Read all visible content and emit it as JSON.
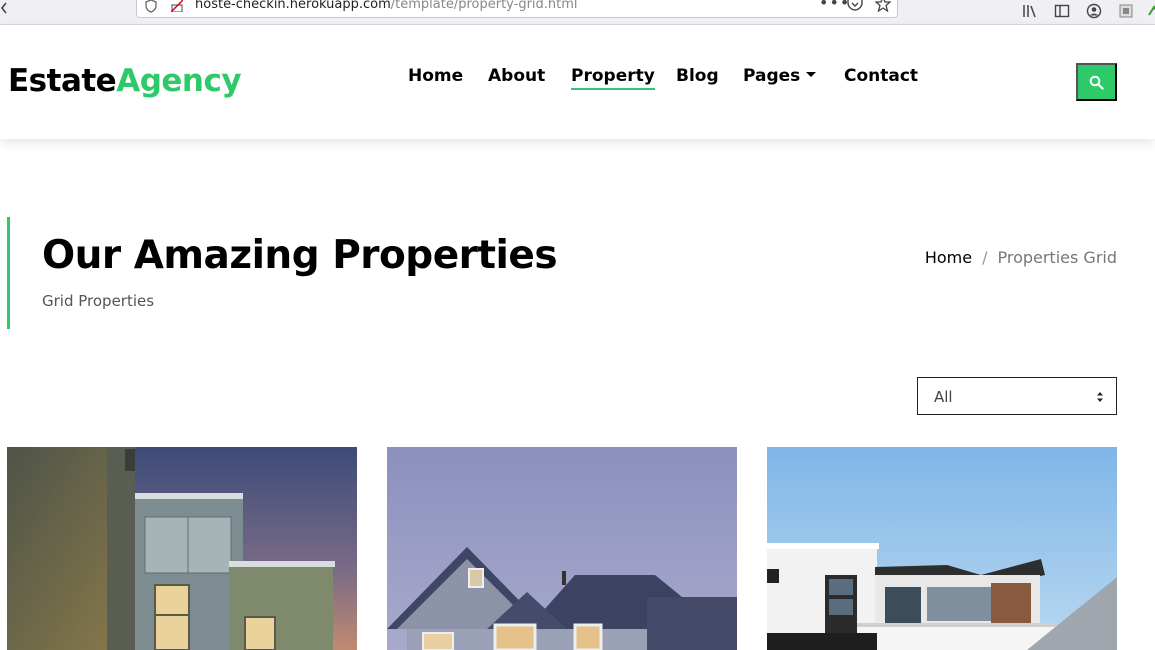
{
  "browser": {
    "url_host": "hoste-checkin.herokuapp.com",
    "url_path": "/template/property-grid.html",
    "menu_dots": "•••"
  },
  "brand": {
    "part1": "Estate",
    "part2": "Agency"
  },
  "nav": {
    "items": [
      {
        "label": "Home"
      },
      {
        "label": "About"
      },
      {
        "label": "Property"
      },
      {
        "label": "Blog"
      },
      {
        "label": "Pages"
      },
      {
        "label": "Contact"
      }
    ],
    "active": "Property"
  },
  "intro": {
    "title": "Our Amazing Properties",
    "subtitle": "Grid Properties"
  },
  "breadcrumb": {
    "home": "Home",
    "separator": "/",
    "current": "Properties Grid"
  },
  "filter": {
    "selected": "All"
  },
  "colors": {
    "accent": "#2eca6a"
  },
  "icons": {
    "search": "search-icon",
    "pages_dropdown": "caret-down-icon"
  }
}
